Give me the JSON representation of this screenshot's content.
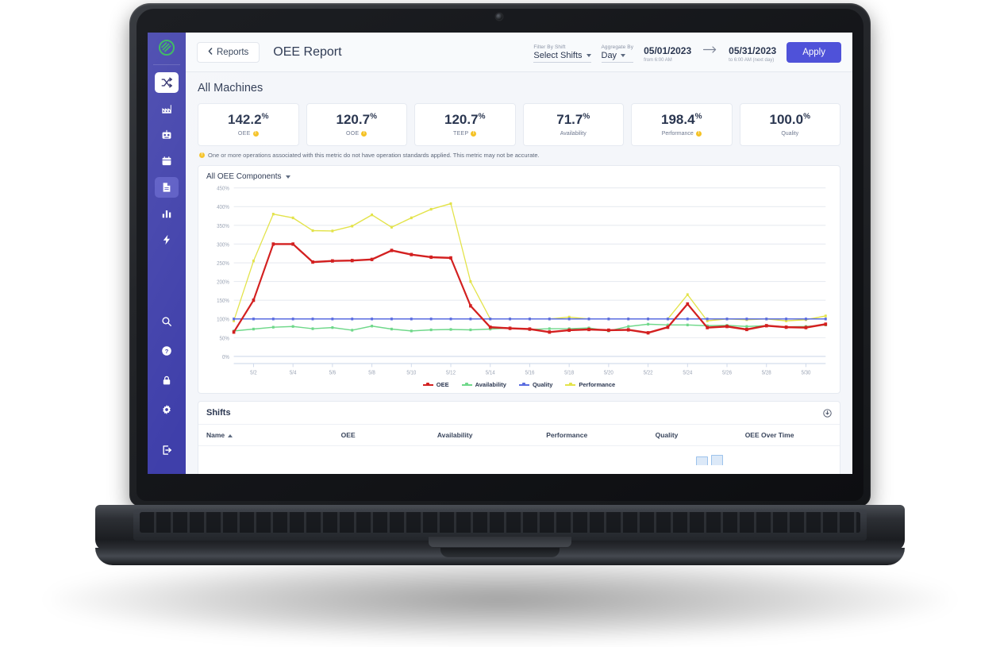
{
  "sidebar": {
    "logo_icon": "leaf-logo-icon",
    "items": [
      {
        "icon": "shuffle-icon",
        "name": "shuffle",
        "state": "active-white"
      },
      {
        "icon": "factory-icon",
        "name": "factory",
        "state": ""
      },
      {
        "icon": "robot-icon",
        "name": "robot",
        "state": ""
      },
      {
        "icon": "calendar-icon",
        "name": "calendar",
        "state": ""
      },
      {
        "icon": "document-icon",
        "name": "reports",
        "state": "active-light"
      },
      {
        "icon": "bar-chart-icon",
        "name": "analytics",
        "state": ""
      },
      {
        "icon": "lightning-icon",
        "name": "energy",
        "state": ""
      }
    ],
    "bottom_items": [
      {
        "icon": "search-icon",
        "name": "search"
      },
      {
        "icon": "help-icon",
        "name": "help"
      },
      {
        "icon": "lock-icon",
        "name": "security"
      },
      {
        "icon": "gear-icon",
        "name": "settings"
      }
    ],
    "logout_icon": "logout-icon"
  },
  "topbar": {
    "back_label": "Reports",
    "back_icon": "chevron-left-icon",
    "page_title": "OEE Report",
    "filter_by_shift": {
      "label": "Filter By Shift",
      "value": "Select Shifts"
    },
    "aggregate_by": {
      "label": "Aggregate By",
      "value": "Day"
    },
    "date_start": {
      "value": "05/01/2023",
      "sub": "from 6:00 AM"
    },
    "date_arrow_icon": "arrow-right-icon",
    "date_end": {
      "value": "05/31/2023",
      "sub": "to 6:00 AM (next day)"
    },
    "apply_label": "Apply"
  },
  "main": {
    "section_title": "All Machines",
    "kpis": [
      {
        "value": "142.2",
        "unit": "%",
        "label": "OEE",
        "warning": true,
        "uppercase": true
      },
      {
        "value": "120.7",
        "unit": "%",
        "label": "OOE",
        "warning": true,
        "uppercase": true
      },
      {
        "value": "120.7",
        "unit": "%",
        "label": "TEEP",
        "warning": true,
        "uppercase": true
      },
      {
        "value": "71.7",
        "unit": "%",
        "label": "Availability",
        "warning": false,
        "uppercase": false
      },
      {
        "value": "198.4",
        "unit": "%",
        "label": "Performance",
        "warning": true,
        "uppercase": false
      },
      {
        "value": "100.0",
        "unit": "%",
        "label": "Quality",
        "warning": false,
        "uppercase": false
      }
    ],
    "warning_banner": "One or more operations associated with this metric do not have operation standards applied. This metric may not be accurate.",
    "chart_dropdown_label": "All OEE Components"
  },
  "chart_data": {
    "type": "line",
    "title": "All OEE Components",
    "xlabel": "",
    "ylabel": "",
    "ylim": [
      0,
      450
    ],
    "grid": true,
    "legend_position": "bottom",
    "y_ticks": [
      "0%",
      "50%",
      "100%",
      "150%",
      "200%",
      "250%",
      "300%",
      "350%",
      "400%",
      "450%"
    ],
    "x_tick_labels": [
      "5/2",
      "5/4",
      "5/6",
      "5/8",
      "5/10",
      "5/12",
      "5/14",
      "5/16",
      "5/18",
      "5/20",
      "5/22",
      "5/24",
      "5/26",
      "5/28",
      "5/30"
    ],
    "x": [
      "5/1",
      "5/2",
      "5/3",
      "5/4",
      "5/5",
      "5/6",
      "5/7",
      "5/8",
      "5/9",
      "5/10",
      "5/11",
      "5/12",
      "5/13",
      "5/14",
      "5/15",
      "5/16",
      "5/17",
      "5/18",
      "5/19",
      "5/20",
      "5/21",
      "5/22",
      "5/23",
      "5/24",
      "5/25",
      "5/26",
      "5/27",
      "5/28",
      "5/29",
      "5/30",
      "5/31"
    ],
    "series": [
      {
        "name": "OEE",
        "color": "#d32020",
        "values": [
          65,
          150,
          300,
          300,
          252,
          255,
          256,
          259,
          283,
          272,
          265,
          263,
          135,
          78,
          75,
          73,
          65,
          70,
          72,
          70,
          71,
          63,
          78,
          140,
          77,
          80,
          72,
          82,
          78,
          77,
          86
        ]
      },
      {
        "name": "Availability",
        "color": "#6fd88a",
        "values": [
          68,
          73,
          78,
          80,
          74,
          77,
          70,
          81,
          73,
          68,
          71,
          72,
          71,
          73,
          76,
          72,
          74,
          74,
          76,
          68,
          80,
          86,
          84,
          84,
          82,
          83,
          80,
          82,
          79,
          80,
          84
        ]
      },
      {
        "name": "Quality",
        "color": "#5a6ce0",
        "values": [
          100,
          100,
          100,
          100,
          100,
          100,
          100,
          100,
          100,
          100,
          100,
          100,
          100,
          100,
          100,
          100,
          100,
          100,
          100,
          100,
          100,
          100,
          100,
          100,
          100,
          100,
          100,
          100,
          100,
          100,
          100
        ]
      },
      {
        "name": "Performance",
        "color": "#e3e34a",
        "values": [
          95,
          255,
          380,
          370,
          336,
          335,
          348,
          378,
          345,
          370,
          393,
          408,
          200,
          100,
          100,
          100,
          100,
          105,
          100,
          100,
          100,
          100,
          100,
          165,
          95,
          100,
          98,
          100,
          95,
          98,
          108
        ]
      }
    ]
  },
  "shifts": {
    "title": "Shifts",
    "download_icon": "download-icon",
    "columns": [
      "Name",
      "OEE",
      "Availability",
      "Performance",
      "Quality",
      "OEE Over Time"
    ],
    "sort_column": "Name",
    "sort_direction": "asc"
  }
}
